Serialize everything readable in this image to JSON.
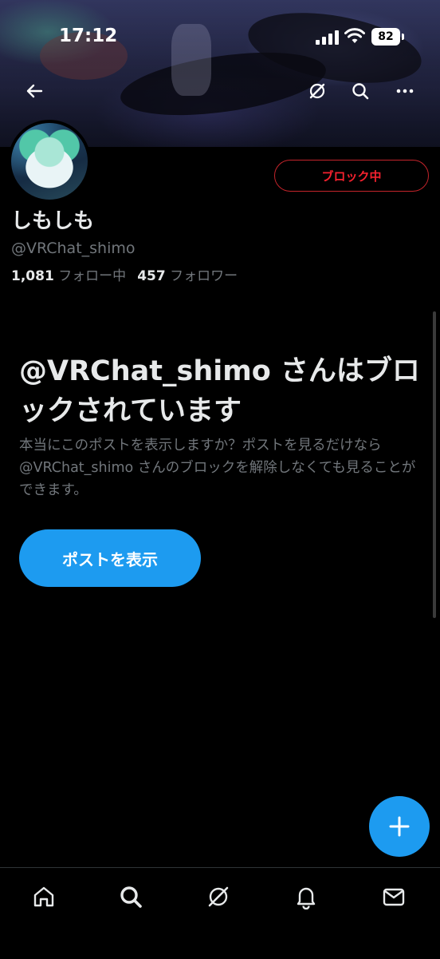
{
  "status_bar": {
    "time": "17:12",
    "battery": "82",
    "icons": [
      "signal-icon",
      "wifi-icon",
      "battery-icon"
    ]
  },
  "top_nav": {
    "icons": [
      "back-arrow-icon",
      "grok-icon",
      "search-icon",
      "more-icon"
    ]
  },
  "profile": {
    "display_name": "しもしも",
    "handle": "@VRChat_shimo",
    "following_count": "1,081",
    "following_label": "フォロー中",
    "followers_count": "457",
    "followers_label": "フォロワー",
    "block_button_label": "ブロック中"
  },
  "blocked_notice": {
    "title": "@VRChat_shimo さんはブロックされています",
    "description": "本当にこのポストを表示しますか？ポストを見るだけなら @VRChat_shimo さんのブロックを解除しなくても見ることができます。",
    "view_posts_button": "ポストを表示"
  },
  "fab": {
    "icon": "plus-icon"
  },
  "tab_bar": {
    "icons": [
      "home-icon",
      "search-icon",
      "grok-icon",
      "notifications-bell-icon",
      "messages-envelope-icon"
    ]
  },
  "colors": {
    "background": "#000000",
    "accent": "#1d9bf0",
    "block_red": "#f4212e",
    "text_primary": "#e7e9ea",
    "text_secondary": "#71767b"
  }
}
